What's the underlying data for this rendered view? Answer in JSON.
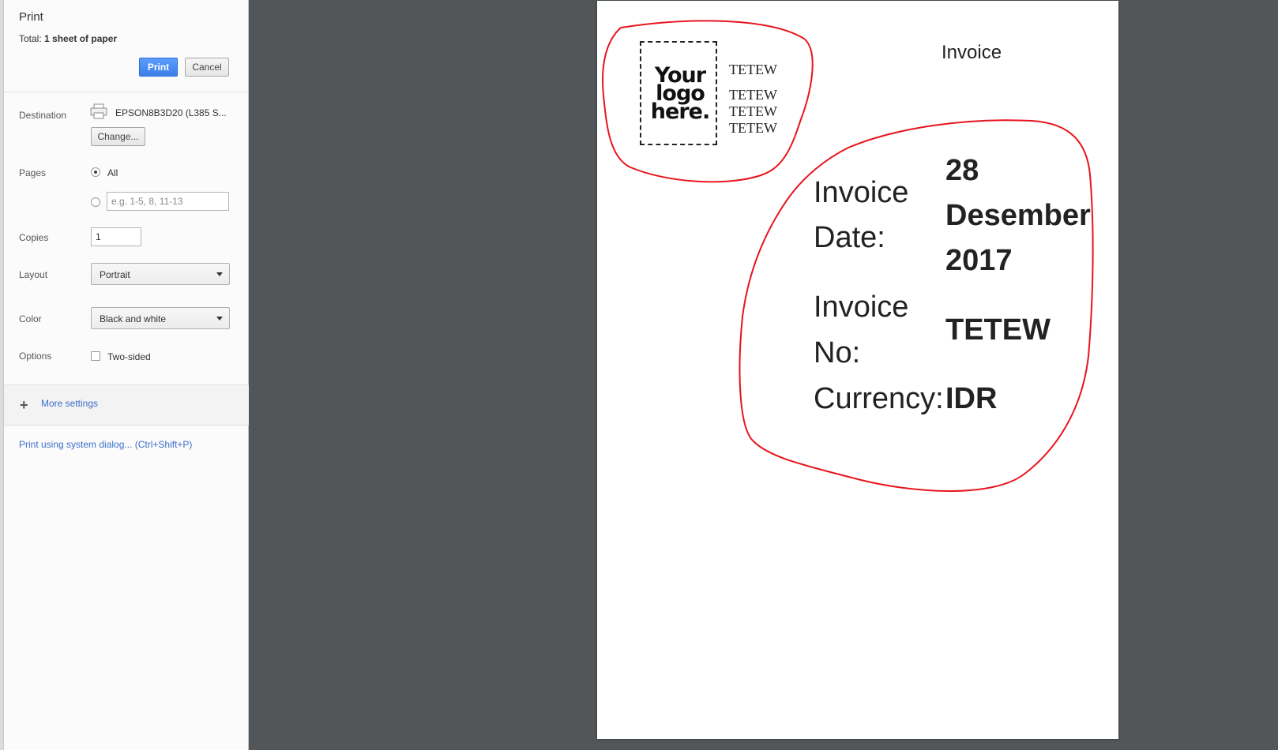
{
  "sidebar": {
    "title": "Print",
    "total_prefix": "Total: ",
    "total_value": "1 sheet of paper",
    "print_label": "Print",
    "cancel_label": "Cancel",
    "destination": {
      "label": "Destination",
      "printer": "EPSON8B3D20 (L385 S...",
      "change_label": "Change..."
    },
    "pages": {
      "label": "Pages",
      "all_label": "All",
      "custom_placeholder": "e.g. 1-5, 8, 11-13"
    },
    "copies": {
      "label": "Copies",
      "value": "1"
    },
    "layout": {
      "label": "Layout",
      "selected": "Portrait"
    },
    "color": {
      "label": "Color",
      "selected": "Black and white"
    },
    "options": {
      "label": "Options",
      "two_sided_label": "Two-sided"
    },
    "more_settings_label": "More settings",
    "system_dialog_label": "Print using system dialog... (Ctrl+Shift+P)"
  },
  "preview": {
    "logo_lines": [
      "Your",
      "logo",
      "here."
    ],
    "company_lines": [
      "TETEW",
      "TETEW",
      "TETEW",
      "TETEW"
    ],
    "heading": "Invoice",
    "invoice_date_label_1": "Invoice",
    "invoice_date_label_2": "Date:",
    "invoice_date_value_1": "28",
    "invoice_date_value_2": "Desember",
    "invoice_date_value_3": "2017",
    "invoice_no_label_1": "Invoice",
    "invoice_no_label_2": "No:",
    "invoice_no_value": "TETEW",
    "currency_label": "Currency:",
    "currency_value": "IDR"
  },
  "colors": {
    "accent": "#3b7fe8",
    "annotation": "#e8141e",
    "backdrop": "#525659"
  }
}
